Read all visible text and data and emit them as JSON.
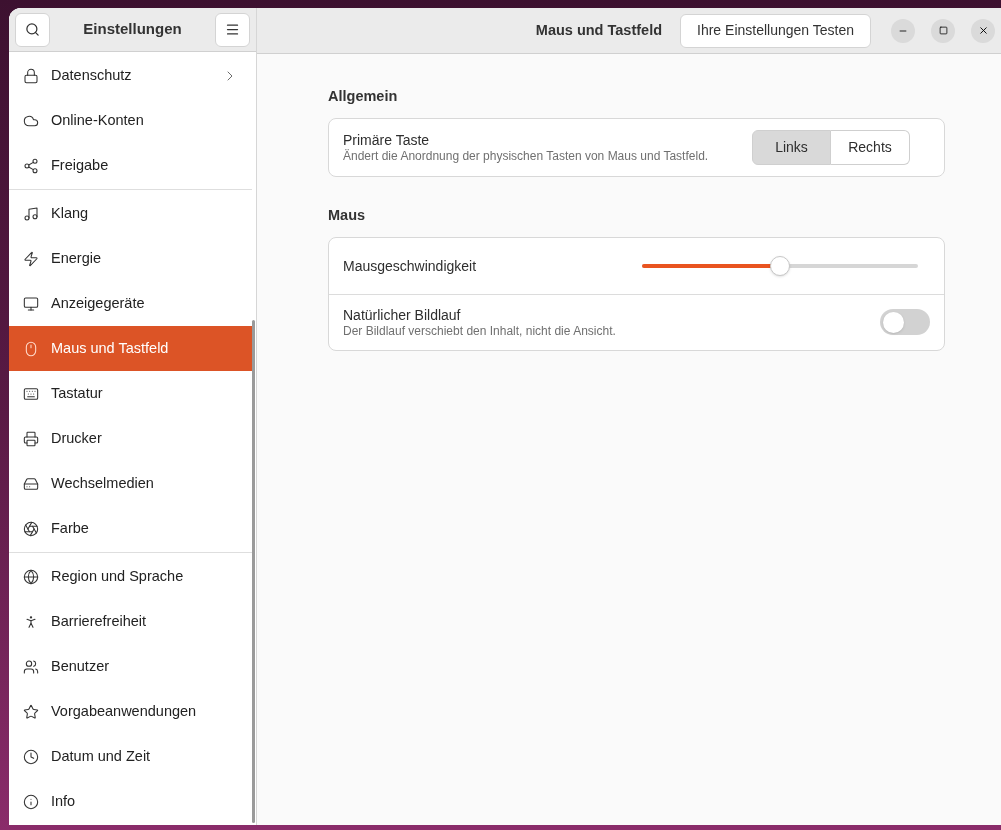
{
  "sidebar": {
    "title": "Einstellungen",
    "groups": [
      [
        {
          "label": "Datenschutz",
          "selected": false,
          "has_submenu": true
        },
        {
          "label": "Online-Konten",
          "selected": false,
          "has_submenu": false
        },
        {
          "label": "Freigabe",
          "selected": false,
          "has_submenu": false
        }
      ],
      [
        {
          "label": "Klang",
          "selected": false,
          "has_submenu": false
        },
        {
          "label": "Energie",
          "selected": false,
          "has_submenu": false
        },
        {
          "label": "Anzeigegeräte",
          "selected": false,
          "has_submenu": false
        },
        {
          "label": "Maus und Tastfeld",
          "selected": true,
          "has_submenu": false
        },
        {
          "label": "Tastatur",
          "selected": false,
          "has_submenu": false
        },
        {
          "label": "Drucker",
          "selected": false,
          "has_submenu": false
        },
        {
          "label": "Wechselmedien",
          "selected": false,
          "has_submenu": false
        },
        {
          "label": "Farbe",
          "selected": false,
          "has_submenu": false
        }
      ],
      [
        {
          "label": "Region und Sprache",
          "selected": false,
          "has_submenu": false
        },
        {
          "label": "Barrierefreiheit",
          "selected": false,
          "has_submenu": false
        },
        {
          "label": "Benutzer",
          "selected": false,
          "has_submenu": false
        },
        {
          "label": "Vorgabeanwendungen",
          "selected": false,
          "has_submenu": false
        },
        {
          "label": "Datum und Zeit",
          "selected": false,
          "has_submenu": false
        },
        {
          "label": "Info",
          "selected": false,
          "has_submenu": false
        }
      ]
    ]
  },
  "header": {
    "title": "Maus und Tastfeld",
    "test_button": "Ihre Einstellungen Testen"
  },
  "sections": [
    {
      "title": "Allgemein",
      "rows": [
        {
          "kind": "segmented",
          "label": "Primäre Taste",
          "description": "Ändert die Anordnung der physischen Tasten von Maus und Tastfeld.",
          "options": [
            {
              "label": "Links",
              "selected": true
            },
            {
              "label": "Rechts",
              "selected": false
            }
          ]
        }
      ]
    },
    {
      "title": "Maus",
      "rows": [
        {
          "kind": "slider",
          "label": "Mausgeschwindigkeit",
          "level": 0.5
        },
        {
          "kind": "switch",
          "label": "Natürlicher Bildlauf",
          "description": "Der Bildlauf verschiebt den Inhalt, nicht die Ansicht.",
          "on": false
        }
      ]
    }
  ]
}
